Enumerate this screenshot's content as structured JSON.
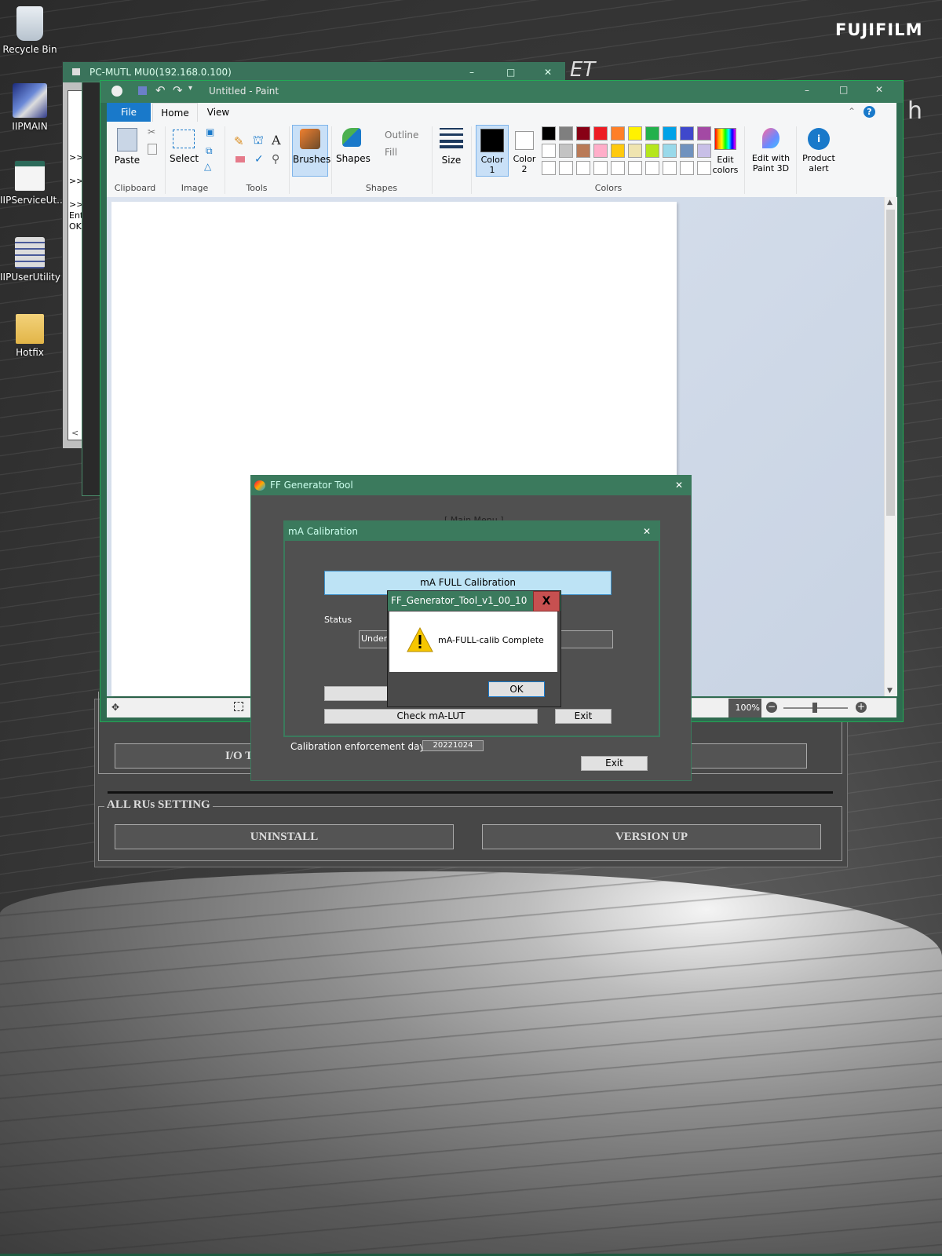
{
  "desktop": {
    "brand": "FUJIFILM",
    "icons": [
      {
        "label": "Recycle Bin"
      },
      {
        "label": "IIPMAIN"
      },
      {
        "label": "IIPServiceUt..."
      },
      {
        "label": "IIPUserUtility"
      },
      {
        "label": "Hotfix"
      }
    ],
    "peek_text_1": "ET",
    "peek_text_2": "h"
  },
  "utility_window": {
    "io_button": "I/O T",
    "group_title": "ALL RUs SETTING",
    "uninstall": "UNINSTALL",
    "version_up": "VERSION UP"
  },
  "mutl_window": {
    "title": "PC-MUTL MU0(192.168.0.100)",
    "console_lines": [
      ">>",
      ">>",
      ">>",
      "Ent",
      "OK"
    ],
    "scroll_left": "<"
  },
  "paint": {
    "title": "Untitled - Paint",
    "tabs": {
      "file": "File",
      "home": "Home",
      "view": "View"
    },
    "clipboard": {
      "paste": "Paste",
      "group": "Clipboard"
    },
    "image": {
      "select": "Select",
      "group": "Image"
    },
    "tools": {
      "group": "Tools",
      "text_tool": "A"
    },
    "brushes": "Brushes",
    "shapes": {
      "label": "Shapes",
      "outline": "Outline",
      "fill": "Fill",
      "group": "Shapes"
    },
    "size": "Size",
    "color1": {
      "line1": "Color",
      "line2": "1"
    },
    "color2": {
      "line1": "Color",
      "line2": "2"
    },
    "colors_group": "Colors",
    "edit_colors": {
      "line1": "Edit",
      "line2": "colors"
    },
    "paint3d": {
      "line1": "Edit with",
      "line2": "Paint 3D"
    },
    "product_alert": {
      "line1": "Product",
      "line2": "alert"
    },
    "palette_row1": [
      "#000000",
      "#7f7f7f",
      "#880015",
      "#ed1c24",
      "#ff7f27",
      "#fff200",
      "#22b14c",
      "#00a2e8",
      "#3f48cc",
      "#a349a4"
    ],
    "palette_row2": [
      "#ffffff",
      "#c3c3c3",
      "#b97a57",
      "#ffaec9",
      "#ffc90e",
      "#efe4b0",
      "#b5e61d",
      "#99d9ea",
      "#7092be",
      "#c8bfe7"
    ],
    "palette_row3": [
      "#ffffff",
      "#ffffff",
      "#ffffff",
      "#ffffff",
      "#ffffff",
      "#ffffff",
      "#ffffff",
      "#ffffff",
      "#ffffff",
      "#ffffff"
    ],
    "zoom": "100%"
  },
  "ff_tool": {
    "title": "FF Generator Tool",
    "main_menu": "[ Main Menu ]",
    "calib_label": "Calibration enforcement day :",
    "calib_date": "20221024",
    "exit": "Exit"
  },
  "ma_calibration": {
    "title": "mA Calibration",
    "full_btn": "mA FULL Calibration",
    "status_label": "Status",
    "status_value": "Under c",
    "check_lut": "Check mA-LUT",
    "exit": "Exit"
  },
  "dialog": {
    "title": "FF_Generator_Tool_v1_00_10",
    "close": "X",
    "message": "mA-FULL-calib Complete",
    "ok": "OK"
  },
  "colors": {
    "window_green": "#3b7a5d",
    "paint_file_blue": "#1979ca",
    "dialog_close_red": "#c75050"
  }
}
